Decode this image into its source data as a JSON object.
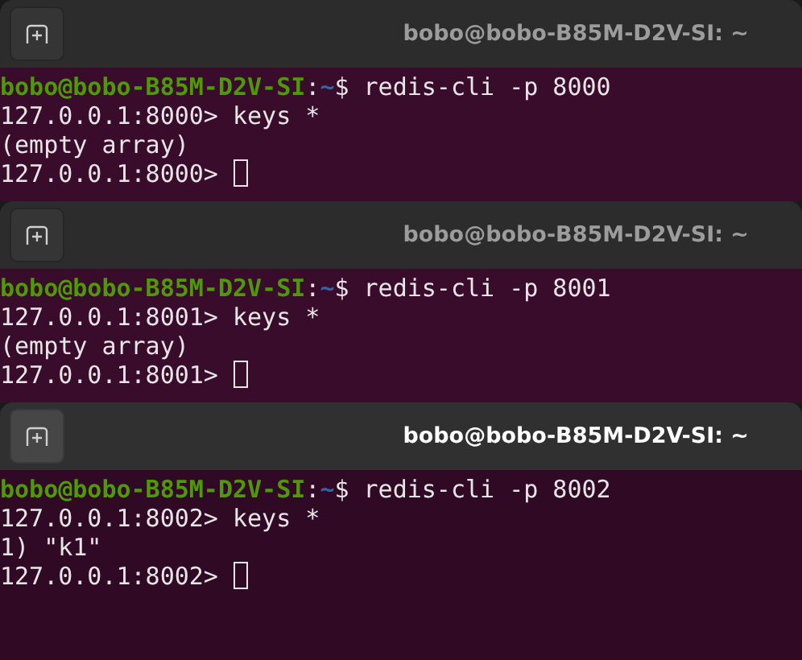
{
  "windows": [
    {
      "title": "bobo@bobo-B85M-D2V-SI: ~",
      "active": false,
      "lines": [
        {
          "kind": "prompt",
          "host": "bobo@bobo-B85M-D2V-SI",
          "colon": ":",
          "path": "~",
          "command": "$ redis-cli -p 8000"
        },
        {
          "kind": "output",
          "text": "127.0.0.1:8000> keys *"
        },
        {
          "kind": "output",
          "text": "(empty array)"
        },
        {
          "kind": "input",
          "text": "127.0.0.1:8000> "
        }
      ]
    },
    {
      "title": "bobo@bobo-B85M-D2V-SI: ~",
      "active": false,
      "lines": [
        {
          "kind": "prompt",
          "host": "bobo@bobo-B85M-D2V-SI",
          "colon": ":",
          "path": "~",
          "command": "$ redis-cli -p 8001"
        },
        {
          "kind": "output",
          "text": "127.0.0.1:8001> keys *"
        },
        {
          "kind": "output",
          "text": "(empty array)"
        },
        {
          "kind": "input",
          "text": "127.0.0.1:8001> "
        }
      ]
    },
    {
      "title": "bobo@bobo-B85M-D2V-SI: ~",
      "active": true,
      "lines": [
        {
          "kind": "prompt",
          "host": "bobo@bobo-B85M-D2V-SI",
          "colon": ":",
          "path": "~",
          "command": "$ redis-cli -p 8002"
        },
        {
          "kind": "output",
          "text": "127.0.0.1:8002> keys *"
        },
        {
          "kind": "output",
          "text": "1) \"k1\""
        },
        {
          "kind": "input",
          "text": "127.0.0.1:8002> "
        }
      ]
    }
  ]
}
